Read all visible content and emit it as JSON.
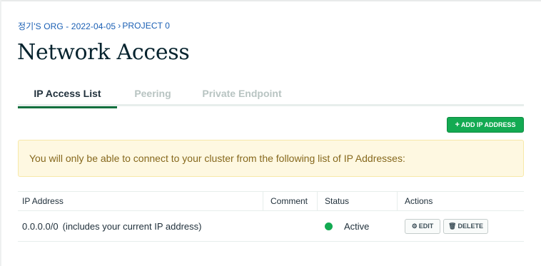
{
  "breadcrumb": {
    "org": "정기'S ORG - 2022-04-05",
    "separator": "›",
    "project": "PROJECT 0"
  },
  "page": {
    "title": "Network Access"
  },
  "tabs": [
    {
      "label": "IP Access List",
      "active": true
    },
    {
      "label": "Peering",
      "active": false
    },
    {
      "label": "Private Endpoint",
      "active": false
    }
  ],
  "toolbar": {
    "add_label": "ADD IP ADDRESS",
    "add_icon": "plus-icon"
  },
  "banner": {
    "text": "You will only be able to connect to your cluster from the following list of IP Addresses:"
  },
  "table": {
    "columns": [
      "IP Address",
      "Comment",
      "Status",
      "Actions"
    ],
    "rows": [
      {
        "ip": "0.0.0.0/0",
        "ip_note": "(includes your current IP address)",
        "comment": "",
        "status": "Active",
        "edit_label": "EDIT",
        "delete_label": "DELETE"
      }
    ]
  },
  "colors": {
    "accent": "#13aa52",
    "tab_underline": "#13703e",
    "link": "#1a5fb4",
    "banner_bg": "#fef8e1",
    "banner_text": "#86681d"
  }
}
